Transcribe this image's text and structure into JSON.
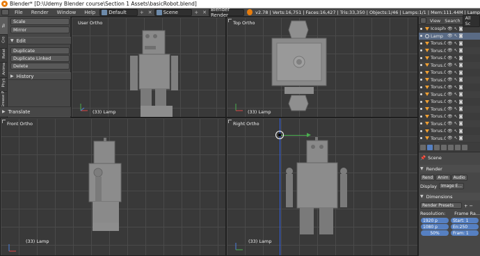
{
  "window": {
    "title": "Blender* [D:\\Udemy Blender course\\Section 1 Assets\\basicRobot.blend]"
  },
  "info_header": {
    "menus": [
      "File",
      "Render",
      "Window",
      "Help"
    ],
    "screen_layout": "Default",
    "scene": "Scene",
    "render_engine": "Blender Render",
    "stats": "v2.78 | Verts:16,751 | Faces:16,427 | Tris:33,350 | Objects:1/46 | Lamps:1/1 | Mem:111.44M | Lamp"
  },
  "toolshelf": {
    "tabs": [
      "To",
      "Cre",
      "Relat",
      "Anima",
      "Phys",
      "Grease P"
    ],
    "buttons_top": [
      "Scale",
      "Mirror"
    ],
    "edit_header": "Edit",
    "edit_buttons": [
      "Duplicate",
      "Duplicate Linked",
      "Delete"
    ],
    "history_header": "History",
    "translate_header": "Translate"
  },
  "viewports": {
    "top_left": {
      "label": "User Ortho",
      "footer": "(33) Lamp"
    },
    "top_right": {
      "label": "Top Ortho",
      "footer": "(33) Lamp"
    },
    "bottom_left": {
      "label": "Front Ortho",
      "footer": "(33) Lamp"
    },
    "bottom_right": {
      "label": "Right Ortho",
      "footer": "(33) Lamp"
    }
  },
  "outliner": {
    "header_tabs": [
      "View",
      "Search",
      "All Sc"
    ],
    "items": [
      {
        "name": "Icosphe",
        "type": "mesh"
      },
      {
        "name": "Lamp",
        "type": "lamp",
        "selected": true
      },
      {
        "name": "Torus.0",
        "type": "mesh"
      },
      {
        "name": "Torus.0",
        "type": "mesh"
      },
      {
        "name": "Torus.0",
        "type": "mesh"
      },
      {
        "name": "Torus.0",
        "type": "mesh"
      },
      {
        "name": "Torus.0",
        "type": "mesh"
      },
      {
        "name": "Torus.0",
        "type": "mesh"
      },
      {
        "name": "Torus.0",
        "type": "mesh"
      },
      {
        "name": "Torus.0",
        "type": "mesh"
      },
      {
        "name": "Torus.0",
        "type": "mesh"
      },
      {
        "name": "Torus.0",
        "type": "mesh"
      },
      {
        "name": "Torus.0",
        "type": "mesh"
      },
      {
        "name": "Torus.0",
        "type": "mesh"
      },
      {
        "name": "Torus.0",
        "type": "mesh"
      },
      {
        "name": "Torus.0",
        "type": "mesh"
      }
    ]
  },
  "properties": {
    "scene_label": "Scene",
    "render_header": "Render",
    "render_buttons": [
      "Rend",
      "Anim",
      "Audio"
    ],
    "display_label": "Display",
    "display_value": "Image E...",
    "dimensions_header": "Dimensions",
    "render_presets": "Render Presets",
    "resolution_label": "Resolution:",
    "frame_range_label": "Frame Ra...",
    "res_x": "1920 p",
    "res_y": "1080 p",
    "res_pct": "50%",
    "frame_start": "Start: 1",
    "frame_end": "En:250",
    "frame_step": "Fram: 1"
  },
  "colors": {
    "accent_blue": "#5680c2",
    "orange_mesh": "#f3a132",
    "viewport_bg": "#393939"
  }
}
